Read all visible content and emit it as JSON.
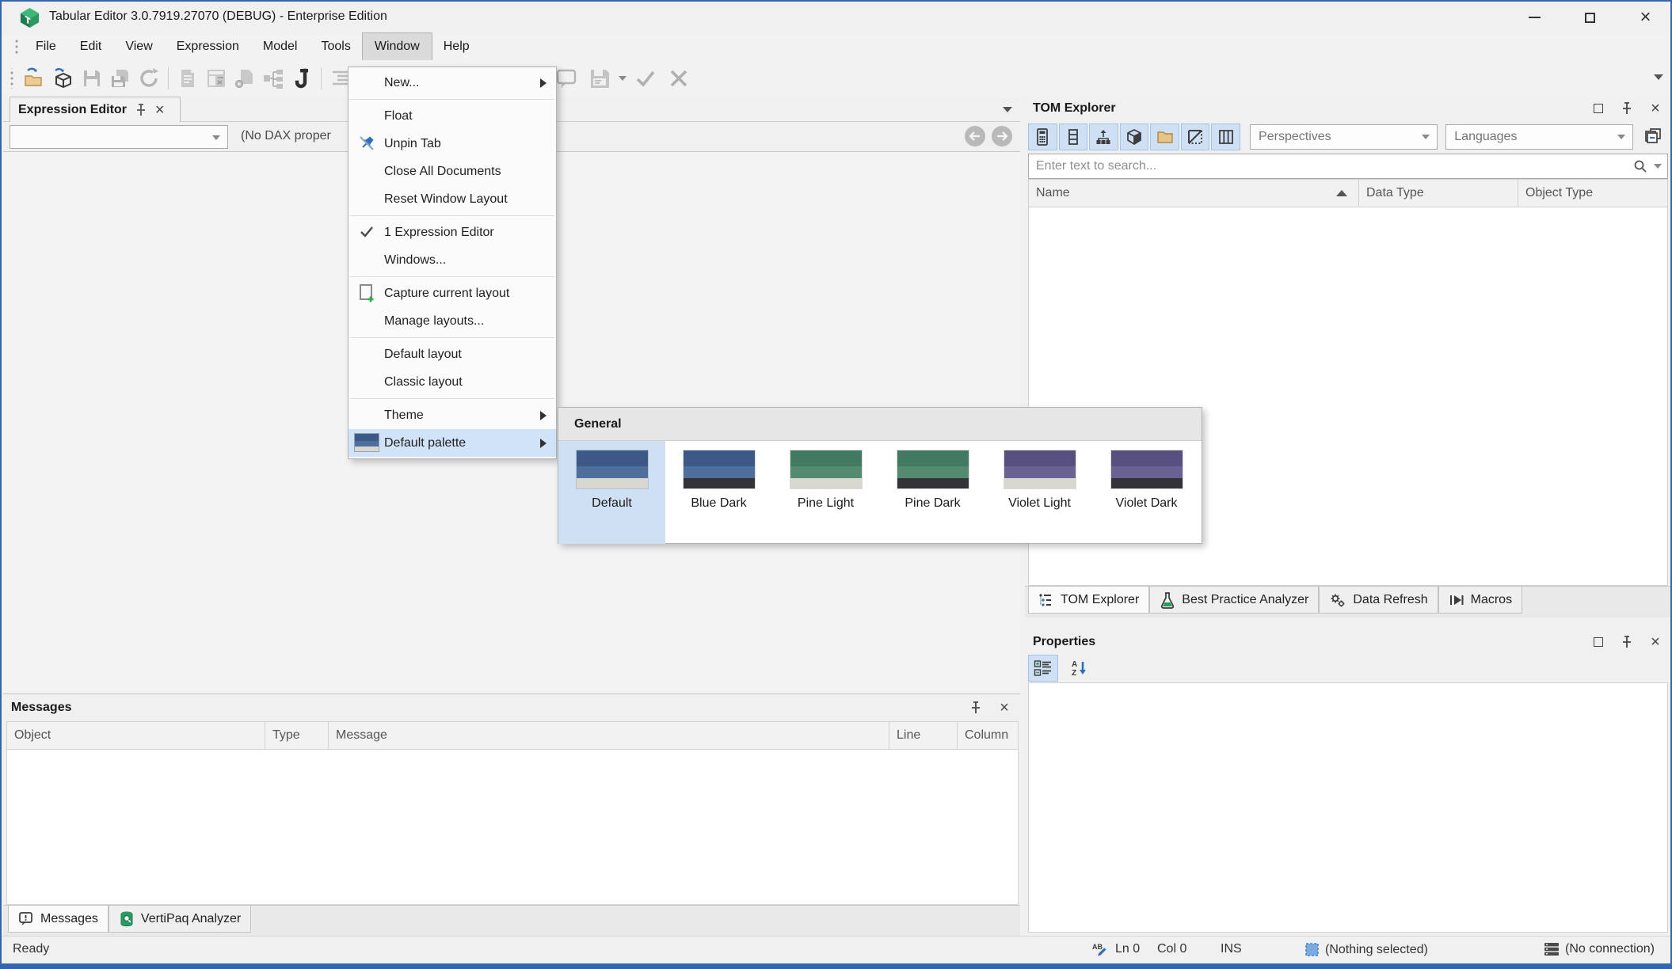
{
  "window": {
    "title": "Tabular Editor 3.0.7919.27070 (DEBUG) - Enterprise Edition",
    "controls": {
      "minimize": "minimize-icon",
      "maximize": "maximize-icon",
      "close": "close-icon"
    }
  },
  "menubar": {
    "items": [
      {
        "label": "File"
      },
      {
        "label": "Edit"
      },
      {
        "label": "View"
      },
      {
        "label": "Expression"
      },
      {
        "label": "Model"
      },
      {
        "label": "Tools"
      },
      {
        "label": "Window",
        "active": true
      },
      {
        "label": "Help"
      }
    ]
  },
  "toolbar": {
    "icons": [
      "open-file-icon",
      "deploy-model-icon",
      "save-icon",
      "save-all-icon",
      "refresh-icon",
      "new-measure-icon",
      "new-calc-table-icon",
      "duplicate-icon",
      "new-hierarchy-icon",
      "dax-script-icon",
      "comment-icon",
      "save-layout-icon",
      "accept-icon",
      "cancel-icon",
      "toolbar-overflow-icon"
    ]
  },
  "expression_editor": {
    "tab_label": "Expression Editor",
    "combo_value": "",
    "dax_status": "(No DAX proper"
  },
  "window_menu": {
    "items": [
      {
        "label": "New...",
        "has_submenu": true
      },
      {
        "label": "Float"
      },
      {
        "label": "Unpin Tab",
        "icon": "unpin-icon"
      },
      {
        "label": "Close All Documents"
      },
      {
        "label": "Reset Window Layout"
      },
      {
        "label": "1 Expression Editor",
        "checked": true
      },
      {
        "label": "Windows..."
      },
      {
        "label": "Capture current layout",
        "icon": "capture-layout-icon"
      },
      {
        "label": "Manage layouts..."
      },
      {
        "label": "Default layout"
      },
      {
        "label": "Classic layout"
      },
      {
        "label": "Theme",
        "has_submenu": true
      },
      {
        "label": "Default palette",
        "icon": "palette-swatch-icon",
        "has_submenu": true,
        "highlighted": true
      }
    ]
  },
  "palette_submenu": {
    "header": "General",
    "items": [
      {
        "label": "Default",
        "selected": true,
        "swatch": [
          "#3d5a87",
          "#4e6e9c",
          "#d8d8d0"
        ]
      },
      {
        "label": "Blue Dark",
        "selected": false,
        "swatch": [
          "#3d5a87",
          "#4e6e9c",
          "#333338"
        ]
      },
      {
        "label": "Pine Light",
        "selected": false,
        "swatch": [
          "#417a60",
          "#538a70",
          "#d8d8d0"
        ]
      },
      {
        "label": "Pine Dark",
        "selected": false,
        "swatch": [
          "#417a60",
          "#538a70",
          "#333338"
        ]
      },
      {
        "label": "Violet Light",
        "selected": false,
        "swatch": [
          "#574f7e",
          "#6a6292",
          "#d8d8d0"
        ]
      },
      {
        "label": "Violet Dark",
        "selected": false,
        "swatch": [
          "#574f7e",
          "#6a6292",
          "#333338"
        ]
      }
    ]
  },
  "tom_explorer": {
    "title": "TOM Explorer",
    "toolbar_icons": [
      "calculator-icon",
      "column-icon",
      "hierarchy-icon",
      "cube-icon",
      "folder-icon",
      "diagonal-square-icon",
      "vertical-columns-icon",
      "stacked-windows-icon"
    ],
    "perspectives_value": "Perspectives",
    "languages_value": "Languages",
    "search_placeholder": "Enter text to search...",
    "columns": [
      "Name",
      "Data Type",
      "Object Type"
    ],
    "tabs": [
      {
        "label": "TOM Explorer",
        "icon": "tree-list-icon",
        "active": true
      },
      {
        "label": "Best Practice Analyzer",
        "icon": "flask-icon",
        "active": false
      },
      {
        "label": "Data Refresh",
        "icon": "gears-icon",
        "active": false
      },
      {
        "label": "Macros",
        "icon": "macro-play-icon",
        "active": false
      }
    ]
  },
  "properties": {
    "title": "Properties",
    "toolbar_icons": [
      "categorized-view-icon",
      "az-sort-icon"
    ]
  },
  "messages": {
    "title": "Messages",
    "columns": [
      "Object",
      "Type",
      "Message",
      "Line",
      "Column"
    ],
    "tabs": [
      {
        "label": "Messages",
        "icon": "message-bubble-icon",
        "active": true
      },
      {
        "label": "VertiPaq Analyzer",
        "icon": "vertipaq-db-icon",
        "active": false
      }
    ]
  },
  "status_bar": {
    "ready": "Ready",
    "line": "Ln 0",
    "column": "Col 0",
    "insert_mode": "INS",
    "selection": "(Nothing selected)",
    "connection": "(No connection)",
    "colors": {
      "accent_blue": "#2d6fbd",
      "window_border": "#3466ad",
      "toggle_bg": "#cfe0f5",
      "menu_highlight": "#d0e3f8"
    }
  }
}
